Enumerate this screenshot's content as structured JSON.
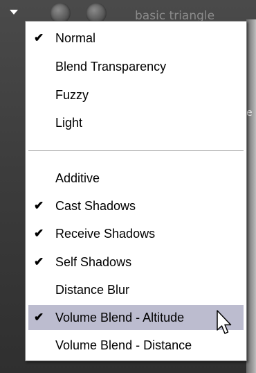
{
  "header": {
    "title": "basic triangle"
  },
  "background": {
    "right_glyph": "e"
  },
  "menu": {
    "items": [
      {
        "label": "Normal",
        "checked": true,
        "check_mark": "✔"
      },
      {
        "label": "Blend Transparency",
        "checked": false,
        "check_mark": ""
      },
      {
        "label": "Fuzzy",
        "checked": false,
        "check_mark": ""
      },
      {
        "label": "Light",
        "checked": false,
        "check_mark": ""
      },
      {
        "label": "Additive",
        "checked": false,
        "check_mark": ""
      },
      {
        "label": "Cast Shadows",
        "checked": true,
        "check_mark": "✔"
      },
      {
        "label": "Receive Shadows",
        "checked": true,
        "check_mark": "✔"
      },
      {
        "label": "Self Shadows",
        "checked": true,
        "check_mark": "✔"
      },
      {
        "label": "Distance Blur",
        "checked": false,
        "check_mark": ""
      },
      {
        "label": "Volume Blend - Altitude",
        "checked": true,
        "check_mark": "✔",
        "highlighted": true
      },
      {
        "label": "Volume Blend - Distance",
        "checked": false,
        "check_mark": ""
      }
    ]
  },
  "colors": {
    "highlight": "#bcbccf",
    "menu_background": "#ffffff",
    "app_background": "#3a3a3a"
  }
}
